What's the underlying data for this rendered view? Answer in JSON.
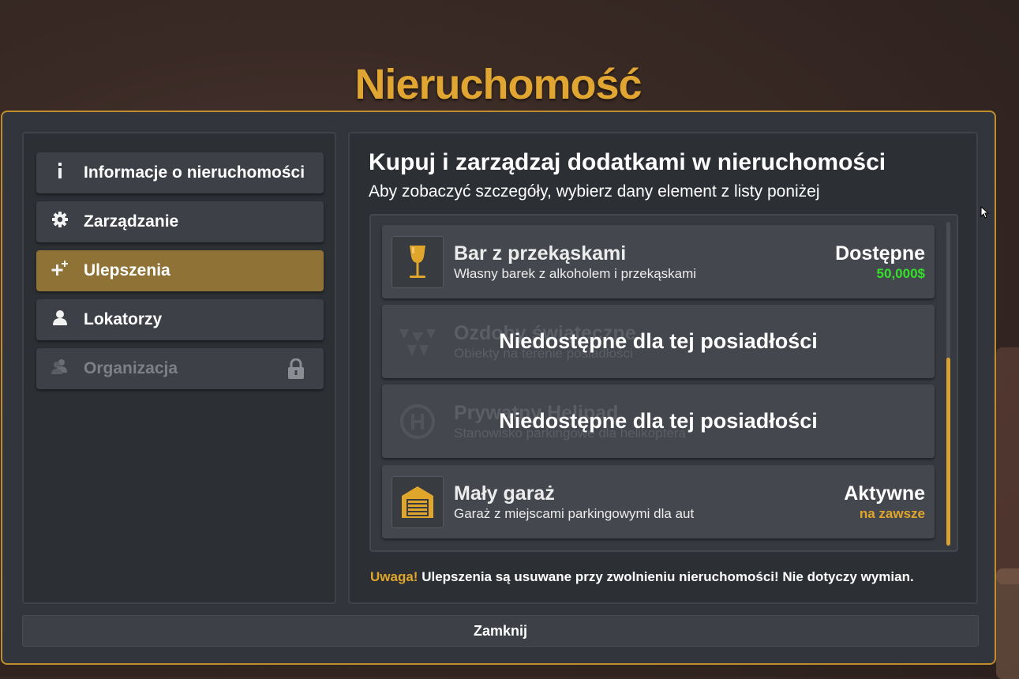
{
  "window": {
    "title": "Nieruchomość"
  },
  "sidebar": {
    "items": [
      {
        "label": "Informacje o nieruchomości",
        "icon": "info-icon",
        "state": "normal"
      },
      {
        "label": "Zarządzanie",
        "icon": "gear-icon",
        "state": "normal"
      },
      {
        "label": "Ulepszenia",
        "icon": "sparkle-plus-icon",
        "state": "active"
      },
      {
        "label": "Lokatorzy",
        "icon": "user-icon",
        "state": "normal"
      },
      {
        "label": "Organizacja",
        "icon": "group-icon",
        "state": "locked"
      }
    ]
  },
  "content": {
    "heading": "Kupuj i zarządzaj dodatkami w nieruchomości",
    "subheading": "Aby zobaczyć szczegóły, wybierz dany element z listy poniżej",
    "upgrades": [
      {
        "title": "Bar z przekąskami",
        "description": "Własny barek z alkoholem i przekąskami",
        "status": "Dostępne",
        "price": "50,000$",
        "icon": "wine-glass-icon"
      },
      {
        "title": "Ozdoby świąteczne",
        "description": "Obiekty na terenie posiadłości",
        "locked_text": "Niedostępne dla tej posiadłości",
        "icon": "ornaments-icon"
      },
      {
        "title": "Prywatny Helipad",
        "description": "Stanowisko parkingowe dla helikoptera",
        "locked_text": "Niedostępne dla tej posiadłości",
        "icon": "helipad-icon"
      },
      {
        "title": "Mały garaż",
        "description": "Garaż z miejscami parkingowymi dla aut",
        "status": "Aktywne",
        "price": "na zawsze",
        "icon": "garage-icon"
      }
    ],
    "warning_label": "Uwaga!",
    "warning_text": " Ulepszenia są usuwane przy zwolnieniu nieruchomości! Nie dotyczy wymian."
  },
  "footer": {
    "close_label": "Zamknij"
  },
  "colors": {
    "accent": "#e1a531",
    "price_green": "#35e02a",
    "status_gold": "#e0a62c",
    "active_tab": "#8f7336"
  }
}
